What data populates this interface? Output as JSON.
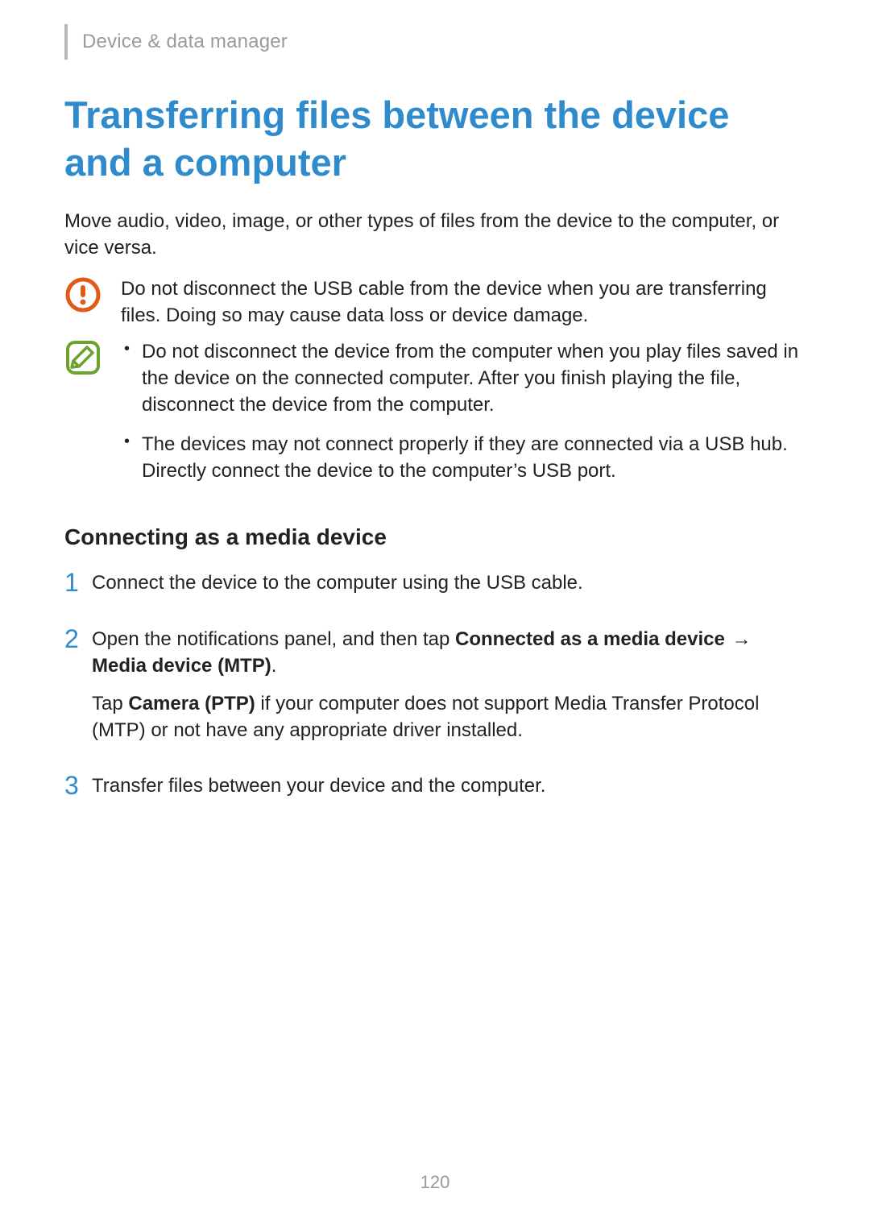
{
  "breadcrumb": "Device & data manager",
  "title": "Transferring files between the device and a computer",
  "intro": "Move audio, video, image, or other types of files from the device to the computer, or vice versa.",
  "notes": {
    "warning": "Do not disconnect the USB cable from the device when you are transferring files. Doing so may cause data loss or device damage.",
    "tips": [
      "Do not disconnect the device from the computer when you play files saved in the device on the connected computer. After you finish playing the file, disconnect the device from the computer.",
      "The devices may not connect properly if they are connected via a USB hub. Directly connect the device to the computer’s USB port."
    ]
  },
  "subheading": "Connecting as a media device",
  "steps": {
    "s1": {
      "num": "1",
      "text": "Connect the device to the computer using the USB cable."
    },
    "s2": {
      "num": "2",
      "pre": "Open the notifications panel, and then tap ",
      "bold1": "Connected as a media device",
      "arrow": " → ",
      "bold2": "Media device (MTP)",
      "post": ".",
      "line2_pre": "Tap ",
      "line2_bold": "Camera (PTP)",
      "line2_post": " if your computer does not support Media Transfer Protocol (MTP) or not have any appropriate driver installed."
    },
    "s3": {
      "num": "3",
      "text": "Transfer files between your device and the computer."
    }
  },
  "page_number": "120"
}
